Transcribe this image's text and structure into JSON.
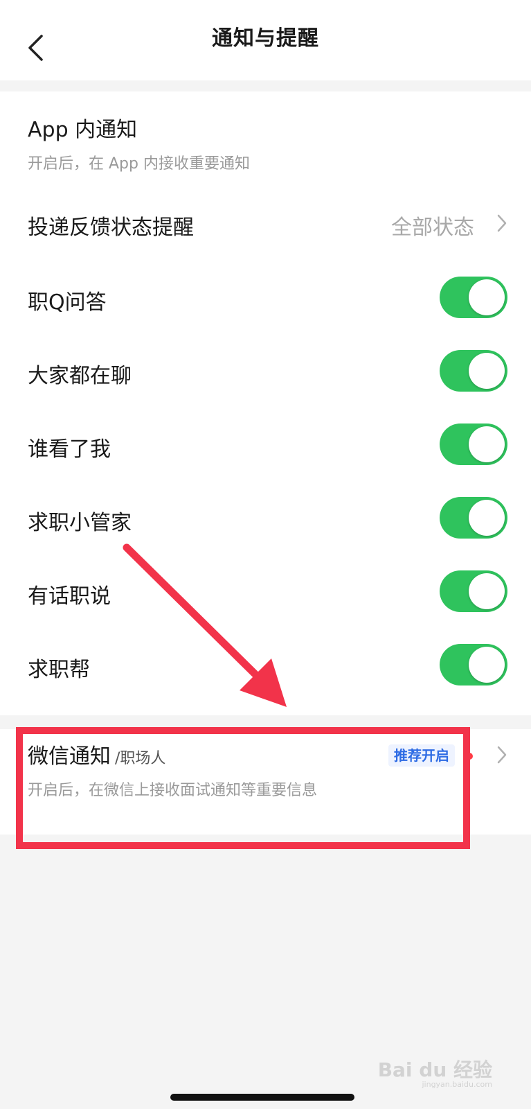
{
  "header": {
    "title": "通知与提醒"
  },
  "in_app": {
    "title": "App 内通知",
    "subtitle": "开启后，在 App 内接收重要通知"
  },
  "delivery": {
    "label": "投递反馈状态提醒",
    "value": "全部状态"
  },
  "toggles": [
    {
      "label": "职Q问答",
      "on": true
    },
    {
      "label": "大家都在聊",
      "on": true
    },
    {
      "label": "谁看了我",
      "on": true
    },
    {
      "label": "求职小管家",
      "on": true
    },
    {
      "label": "有话职说",
      "on": true
    },
    {
      "label": "求职帮",
      "on": true
    }
  ],
  "wechat": {
    "title": "微信通知",
    "suffix": "/职场人",
    "badge": "推荐开启",
    "subtitle": "开启后，在微信上接收面试通知等重要信息"
  },
  "watermark": {
    "brand": "Bai du 经验",
    "url": "jingyan.baidu.com"
  },
  "colors": {
    "toggle_on": "#2fc35d",
    "badge_text": "#2d6be4",
    "annotation": "#f2334a"
  }
}
